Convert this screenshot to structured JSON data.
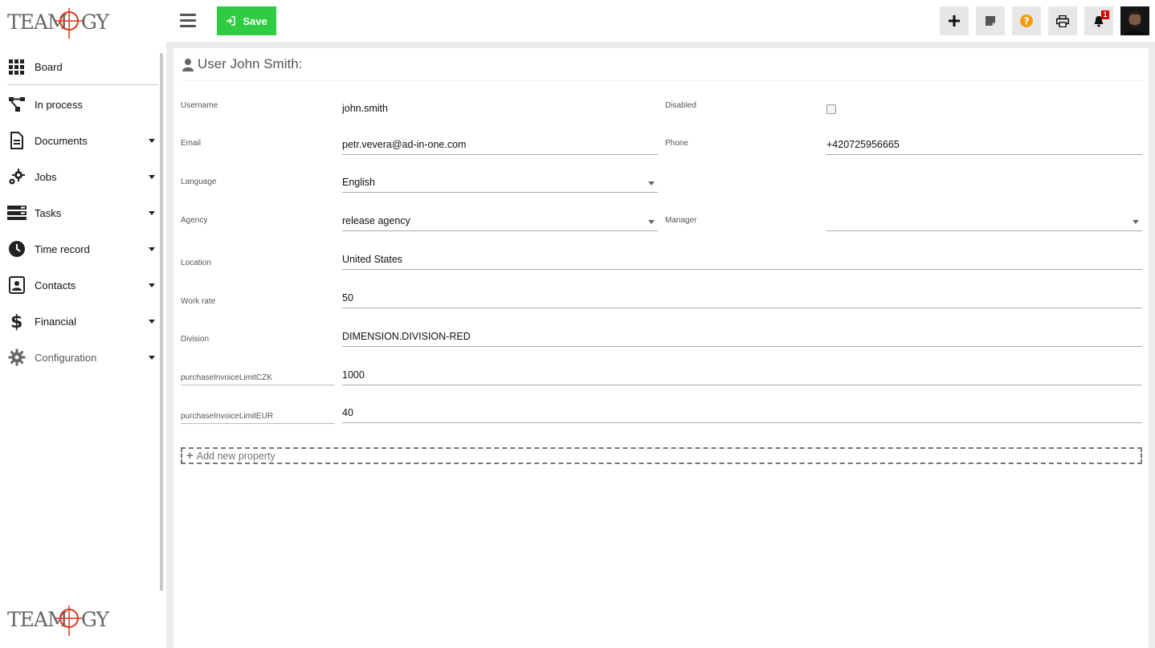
{
  "brand": {
    "logo_text": "TEAMOGY"
  },
  "sidebar": {
    "items": [
      {
        "label": "Board",
        "icon": "grid-icon",
        "has_caret": false
      },
      {
        "label": "In process",
        "icon": "workflow-icon",
        "has_caret": false
      },
      {
        "label": "Documents",
        "icon": "document-icon",
        "has_caret": true
      },
      {
        "label": "Jobs",
        "icon": "gears-icon",
        "has_caret": true
      },
      {
        "label": "Tasks",
        "icon": "tasks-icon",
        "has_caret": true
      },
      {
        "label": "Time record",
        "icon": "clock-icon",
        "has_caret": true
      },
      {
        "label": "Contacts",
        "icon": "contact-card-icon",
        "has_caret": true
      },
      {
        "label": "Financial",
        "icon": "dollar-icon",
        "has_caret": true
      },
      {
        "label": "Configuration",
        "icon": "gear-icon",
        "has_caret": true
      }
    ]
  },
  "toolbar": {
    "save_label": "Save",
    "notification_count": "1"
  },
  "page": {
    "title": "User John Smith:"
  },
  "form": {
    "username": {
      "label": "Username",
      "value": "john.smith"
    },
    "disabled": {
      "label": "Disabled",
      "checked": false
    },
    "email": {
      "label": "Email",
      "value": "petr.vevera@ad-in-one.com"
    },
    "phone": {
      "label": "Phone",
      "value": "+420725956665"
    },
    "language": {
      "label": "Language",
      "value": "English"
    },
    "agency": {
      "label": "Agency",
      "value": "release agency"
    },
    "manager": {
      "label": "Manager",
      "value": ""
    },
    "location": {
      "label": "Location",
      "value": "United States"
    },
    "work_rate": {
      "label": "Work rate",
      "value": "50"
    },
    "division": {
      "label": "Division",
      "value": "DIMENSION.DIVISION-RED"
    },
    "purchase_czk": {
      "label": "purchaseInvoiceLimitCZK",
      "value": "1000"
    },
    "purchase_eur": {
      "label": "purchaseInvoiceLimitEUR",
      "value": "40"
    },
    "add_property_label": "Add new property"
  },
  "colors": {
    "save": "#2ecc40",
    "help": "#f39c12",
    "badge": "#dd0000",
    "logo_accent": "#d9381e"
  }
}
